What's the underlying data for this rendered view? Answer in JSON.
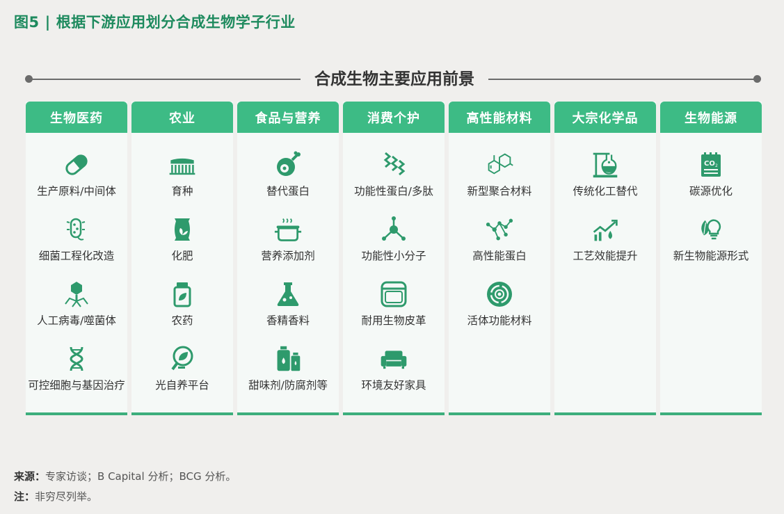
{
  "title": {
    "fig": "图5",
    "sep": "|",
    "text": "根据下游应用划分合成生物学子行业"
  },
  "heading": "合成生物主要应用前景",
  "colors": {
    "accent": "#3dbb85",
    "title": "#1e8a5e",
    "background": "#f0efed"
  },
  "columns": [
    {
      "header": "生物医药",
      "items": [
        {
          "label": "生产原料/中间体",
          "icon": "capsule-icon"
        },
        {
          "label": "细菌工程化改造",
          "icon": "bacterium-icon"
        },
        {
          "label": "人工病毒/噬菌体",
          "icon": "virus-icon"
        },
        {
          "label": "可控细胞与基因治疗",
          "icon": "dna-icon"
        }
      ]
    },
    {
      "header": "农业",
      "items": [
        {
          "label": "育种",
          "icon": "toothbrush-field-icon"
        },
        {
          "label": "化肥",
          "icon": "fertilizer-bag-icon"
        },
        {
          "label": "农药",
          "icon": "pesticide-jar-icon"
        },
        {
          "label": "光自养平台",
          "icon": "leaf-bulb-icon"
        }
      ]
    },
    {
      "header": "食品与营养",
      "items": [
        {
          "label": "替代蛋白",
          "icon": "meat-icon"
        },
        {
          "label": "营养添加剂",
          "icon": "pot-icon"
        },
        {
          "label": "香精香料",
          "icon": "flask-icon"
        },
        {
          "label": "甜味剂/防腐剂等",
          "icon": "bottles-icon"
        }
      ]
    },
    {
      "header": "消费个护",
      "items": [
        {
          "label": "功能性蛋白/多肽",
          "icon": "peptide-icon"
        },
        {
          "label": "功能性小分子",
          "icon": "molecule-icon"
        },
        {
          "label": "耐用生物皮革",
          "icon": "leather-icon"
        },
        {
          "label": "环境友好家具",
          "icon": "sofa-icon"
        }
      ]
    },
    {
      "header": "高性能材料",
      "items": [
        {
          "label": "新型聚合材料",
          "icon": "hexagon-structure-icon"
        },
        {
          "label": "高性能蛋白",
          "icon": "network-icon"
        },
        {
          "label": "活体功能材料",
          "icon": "circular-target-icon"
        }
      ]
    },
    {
      "header": "大宗化学品",
      "items": [
        {
          "label": "传统化工替代",
          "icon": "lab-flask-stand-icon"
        },
        {
          "label": "工艺效能提升",
          "icon": "growth-chart-icon"
        }
      ]
    },
    {
      "header": "生物能源",
      "items": [
        {
          "label": "碳源优化",
          "icon": "co2-note-icon"
        },
        {
          "label": "新生物能源形式",
          "icon": "leaf-bulb-energy-icon"
        }
      ]
    }
  ],
  "footer": {
    "source_label": "来源：",
    "source_text": "专家访谈；B Capital 分析；BCG 分析。",
    "note_label": "注：",
    "note_text": "非穷尽列举。"
  }
}
